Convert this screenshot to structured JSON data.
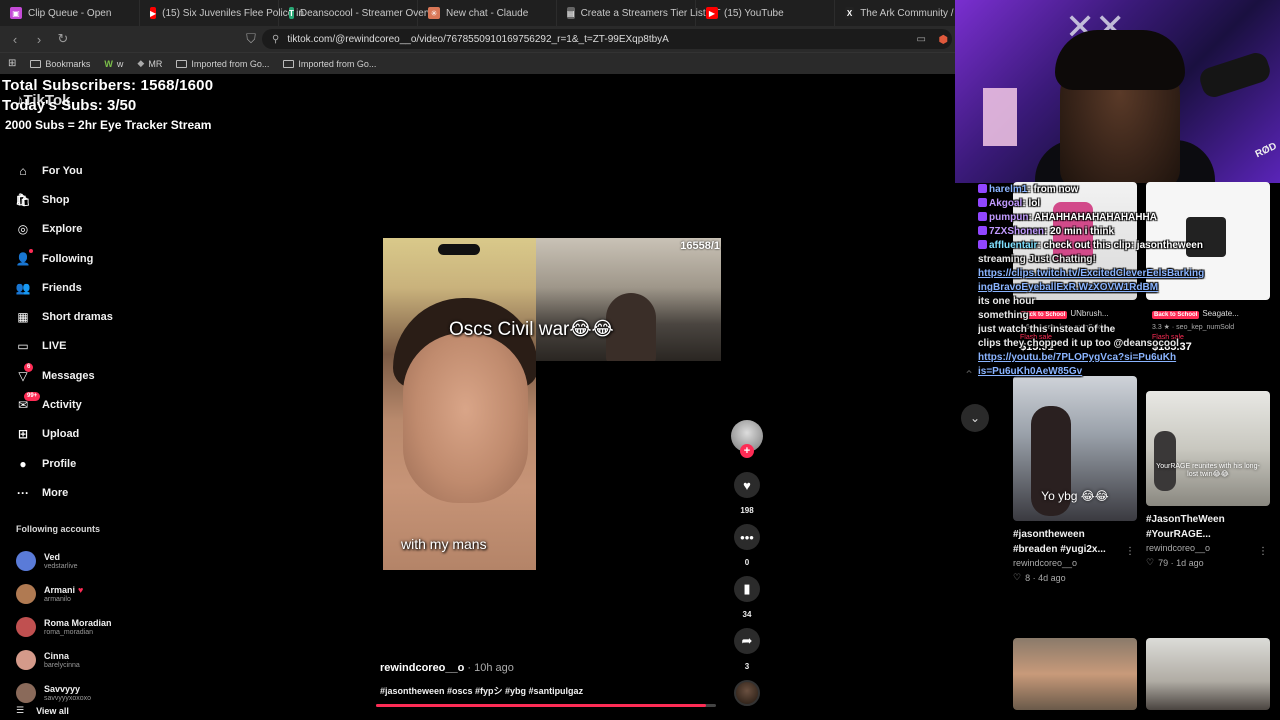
{
  "browser": {
    "tabs": [
      {
        "title": "Clip Queue - Open",
        "color": "#c54bd8",
        "glyph": "▣"
      },
      {
        "title": "(15) Six Juveniles Flee Police in",
        "color": "#ff0000",
        "glyph": "▶"
      },
      {
        "title": "Deansocool - Streamer Overvi",
        "color": "#2aa876",
        "glyph": "T"
      },
      {
        "title": "New chat - Claude",
        "color": "#d97757",
        "glyph": "✳"
      },
      {
        "title": "Create a Streamers Tier List - T",
        "color": "#666666",
        "glyph": "▤"
      },
      {
        "title": "(15) YouTube",
        "color": "#ff0000",
        "glyph": "▶"
      },
      {
        "title": "The Ark Community / X",
        "color": "#222222",
        "glyph": "X"
      }
    ],
    "url": "tiktok.com/@rewindcoreo__o/video/7678550910169756292_r=1&_t=ZT-99EXqp8tbyA",
    "bookmarks": [
      {
        "label": "Bookmarks",
        "icon": "bookmark-icon"
      },
      {
        "label": "w",
        "icon": "w-icon"
      },
      {
        "label": "MR",
        "icon": "mr-icon"
      },
      {
        "label": "Imported from Go...",
        "icon": "folder-icon"
      },
      {
        "label": "Imported from Go...",
        "icon": "folder-icon"
      }
    ]
  },
  "overlay": {
    "line1": "Total Subscribers: 1568/1600",
    "line2": "Today's Subs: 3/50",
    "line3": "2000 Subs = 2hr Eye Tracker Stream",
    "logo": "TikTok"
  },
  "sidebar": {
    "items": [
      {
        "label": "For You",
        "icon": "home-icon",
        "glyph": "⌂"
      },
      {
        "label": "Shop",
        "icon": "shop-icon",
        "glyph": "🛍"
      },
      {
        "label": "Explore",
        "icon": "compass-icon",
        "glyph": "◎"
      },
      {
        "label": "Following",
        "icon": "following-icon",
        "glyph": "👤",
        "dot": true
      },
      {
        "label": "Friends",
        "icon": "friends-icon",
        "glyph": "👥"
      },
      {
        "label": "Short dramas",
        "icon": "short-dramas-icon",
        "glyph": "▦"
      },
      {
        "label": "LIVE",
        "icon": "live-icon",
        "glyph": "▭"
      },
      {
        "label": "Messages",
        "icon": "messages-icon",
        "glyph": "▽",
        "badge": "6"
      },
      {
        "label": "Activity",
        "icon": "activity-icon",
        "glyph": "✉",
        "badge": "99+"
      },
      {
        "label": "Upload",
        "icon": "upload-icon",
        "glyph": "⊞"
      },
      {
        "label": "Profile",
        "icon": "profile-icon",
        "glyph": "●"
      },
      {
        "label": "More",
        "icon": "more-icon",
        "glyph": "···"
      }
    ],
    "following_header": "Following accounts",
    "following": [
      {
        "name": "Ved",
        "handle": "vedstarlive",
        "color": "#5a7bd8"
      },
      {
        "name": "Armani",
        "handle": "armanilo",
        "color": "#b07a52",
        "heart": "♥"
      },
      {
        "name": "Roma Moradian",
        "handle": "roma_moradian",
        "color": "#c05050"
      },
      {
        "name": "Cinna",
        "handle": "barelycinna",
        "color": "#d49a8a"
      },
      {
        "name": "Savvyyy",
        "handle": "savvyyyxoxoxo",
        "color": "#8a6a5a"
      }
    ],
    "view_all": "View all"
  },
  "video": {
    "title": "Oscs Civil war😂😂",
    "caption": "with my mans",
    "counter": "16558/1",
    "author": "rewindcoreo__o",
    "time": " · 10h ago",
    "tags": "#jasontheween #oscs #fypシ #ybg #santipulgaz",
    "progress": 0.97,
    "likes": "198",
    "comments": "0",
    "saves": "34",
    "shares": "3"
  },
  "webcam": {
    "mic_label": "RØD"
  },
  "grid": {
    "cards": [
      {
        "caption": "",
        "author": "",
        "stat": ""
      },
      {
        "caption": "",
        "author": "",
        "stat": ""
      },
      {
        "caption": "#jasontheween\n#breaden #yugi2x...",
        "author": "rewindcoreo__o",
        "stat": "8 · 4d ago",
        "thumb_text": "Yo ybg 😂😂"
      },
      {
        "caption": "#JasonTheWeen\n#YourRAGE...",
        "author": "rewindcoreo__o",
        "stat": "79 · 1d ago",
        "thumb_text": "YourRAGE reunites with his long-lost twin😂😂"
      }
    ],
    "shop": [
      {
        "tag": "Back to School",
        "name": "UNbrush...",
        "rating": "4.6 ★ · seo_kep_numSold",
        "sale": "Flash sale",
        "price": "$15.91"
      },
      {
        "tag": "Back to School",
        "name": "Seagate...",
        "rating": "3.3 ★ · seo_kep_numSold",
        "sale": "Flash sale",
        "price": "$185.37"
      }
    ]
  },
  "chat": {
    "lines": [
      {
        "user": "harelm1",
        "text": ": from now",
        "cls": "u-blue"
      },
      {
        "user": "Akgoal",
        "text": ": lol",
        "cls": "u-purple"
      },
      {
        "user": "pumpun",
        "text": ": AHAHHAHAHAHAHAHHA",
        "cls": "u-purple"
      },
      {
        "user": "7ZXShonen",
        "text": ": 20 min i think",
        "cls": "u-purple"
      },
      {
        "user": "affluentair",
        "text": ": check out this clip: jasontheween",
        "cls": "u-cyan"
      },
      {
        "user": "",
        "text": "streaming Just Chatting!",
        "cls": ""
      },
      {
        "user": "",
        "text": "https://clips.twitch.tv/ExcitedCleverEelsBarking",
        "cls": "link"
      },
      {
        "user": "",
        "text": "ingBravoEyeballExR.WzXOVW1RdBM",
        "cls": "link"
      },
      {
        "user": "",
        "text": "its one hour",
        "cls": ""
      },
      {
        "user": "",
        "text": "something",
        "cls": ""
      },
      {
        "user": "",
        "text": "just watch this instead of the",
        "cls": ""
      },
      {
        "user": "",
        "text": "clips they chopped it up too @deansocool",
        "cls": ""
      },
      {
        "user": "",
        "text": "https://youtu.be/7PLOPygVca?si=Pu6uKh",
        "cls": "link"
      },
      {
        "user": "",
        "text": "is=Pu6uKh0AeW85Gv",
        "cls": "link"
      }
    ]
  }
}
